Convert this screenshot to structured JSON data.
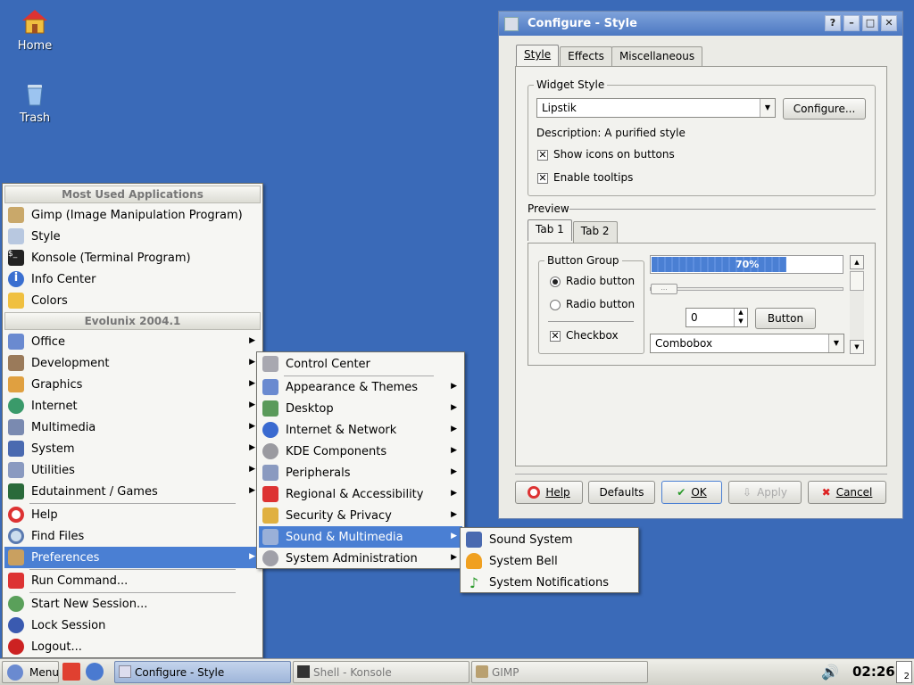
{
  "desktop": {
    "icons": [
      {
        "label": "Home"
      },
      {
        "label": "Trash"
      }
    ]
  },
  "window": {
    "title": "Configure - Style",
    "controls": [
      "?",
      "–",
      "□",
      "✕"
    ],
    "tabs": [
      "Style",
      "Effects",
      "Miscellaneous"
    ],
    "widget_style": {
      "legend": "Widget Style",
      "combo_value": "Lipstik",
      "configure_label": "Configure...",
      "description": "Description: A purified style",
      "show_icons_label": "Show icons on buttons",
      "show_icons_checked": true,
      "tooltips_label": "Enable tooltips",
      "tooltips_checked": true
    },
    "preview": {
      "label": "Preview",
      "tabs": [
        "Tab 1",
        "Tab 2"
      ],
      "button_group_legend": "Button Group",
      "radio1": "Radio button",
      "radio2": "Radio button",
      "checkbox": "Checkbox",
      "progress_text": "70%",
      "progress_value": 0.7,
      "slider_value": "...",
      "spin_value": "0",
      "button_label": "Button",
      "combo_value": "Combobox"
    },
    "buttons": {
      "help": "Help",
      "defaults": "Defaults",
      "ok": "OK",
      "apply": "Apply",
      "cancel": "Cancel"
    }
  },
  "kmenu": {
    "header_most_used": "Most Used Applications",
    "most_used": [
      "Gimp (Image Manipulation Program)",
      "Style",
      "Konsole (Terminal Program)",
      "Info Center",
      "Colors"
    ],
    "header_distro": "Evolunix 2004.1",
    "categories": [
      "Office",
      "Development",
      "Graphics",
      "Internet",
      "Multimedia",
      "System",
      "Utilities",
      "Edutainment / Games"
    ],
    "actions": [
      "Help",
      "Find Files",
      "Preferences"
    ],
    "session": [
      "Run Command...",
      "Start New Session...",
      "Lock Session",
      "Logout..."
    ]
  },
  "prefs_menu": {
    "items": [
      "Control Center",
      "Appearance & Themes",
      "Desktop",
      "Internet & Network",
      "KDE Components",
      "Peripherals",
      "Regional & Accessibility",
      "Security & Privacy",
      "Sound & Multimedia",
      "System Administration"
    ]
  },
  "sound_menu": {
    "items": [
      "Sound System",
      "System Bell",
      "System Notifications"
    ]
  },
  "taskbar": {
    "menu_label": "Menu",
    "tasks": [
      "Configure - Style",
      "Shell - Konsole",
      "GIMP"
    ],
    "clock": "02:26",
    "desktop_number": "2"
  },
  "colors": {
    "desktop": "#3a6ab8",
    "highlight": "#4a7fd3",
    "titlebar": "#5a84c8"
  }
}
